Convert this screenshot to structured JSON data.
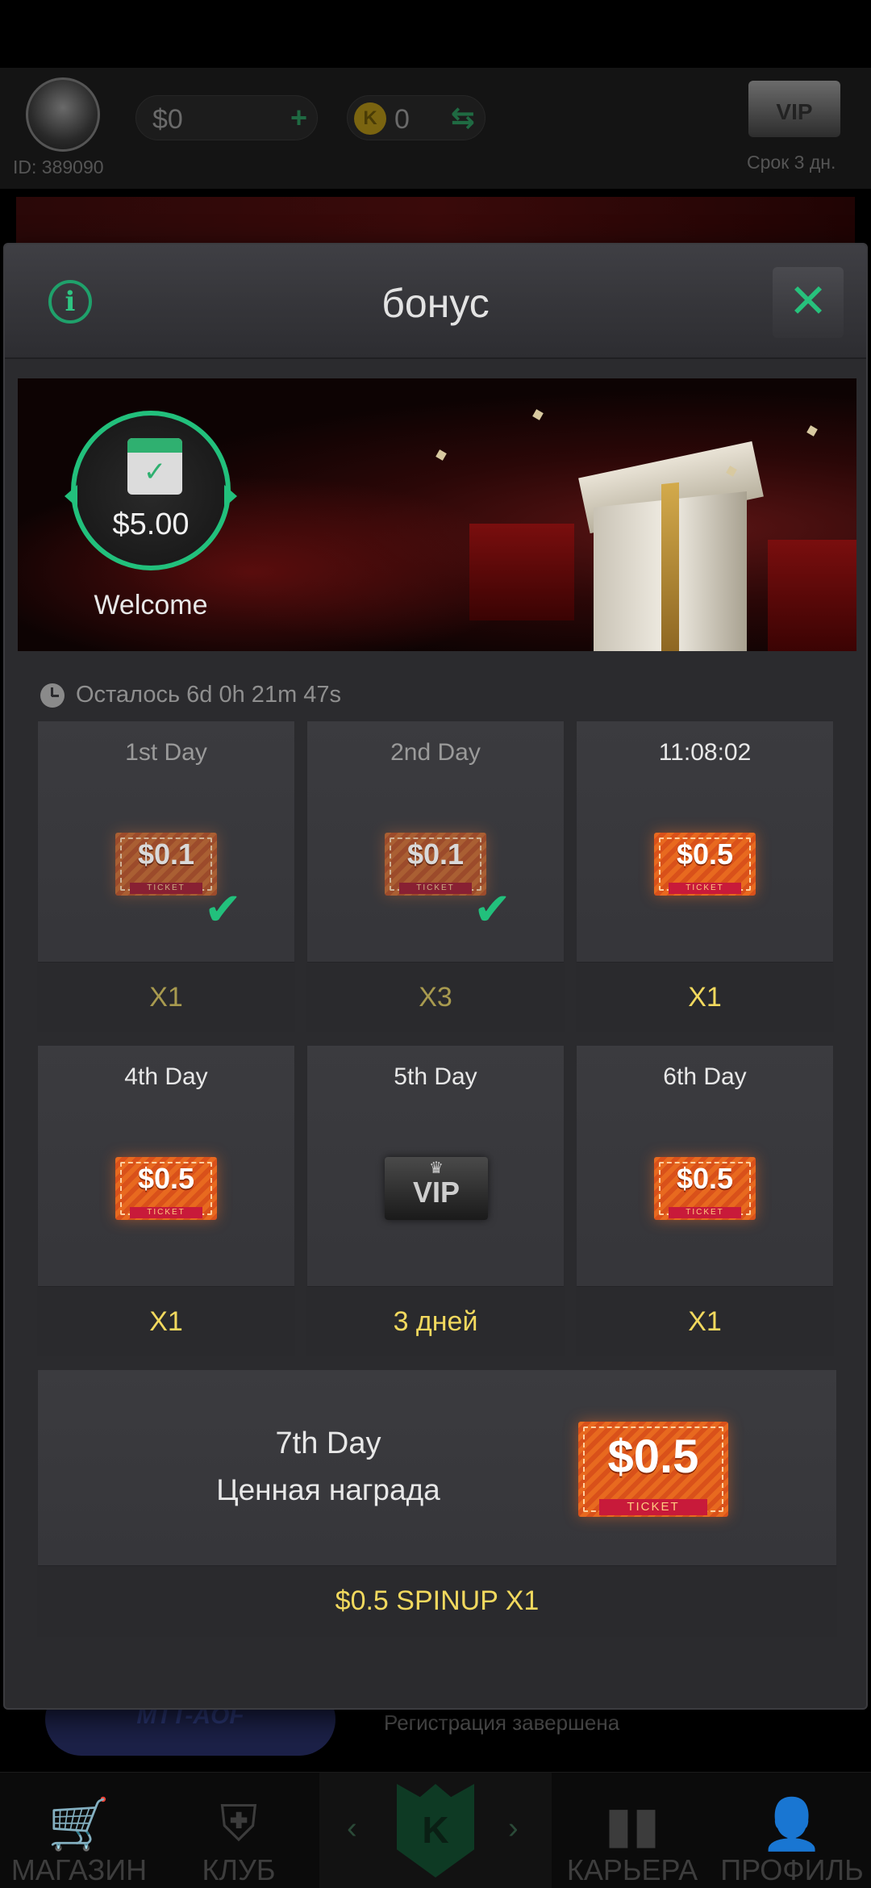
{
  "background": {
    "user_id": "ID: 389090",
    "cash": "$0",
    "cash_action": "+",
    "coin_icon_letter": "K",
    "coins": "0",
    "coin_action": "⇆",
    "vip_label": "VIP",
    "vip_expiry": "Срок 3 дн.",
    "mtt_label": "MTT-AOF",
    "registration_status": "Регистрация завершена",
    "nav": {
      "shop": "МАГАЗИН",
      "club": "КЛУБ",
      "career": "КАРЬЕРА",
      "profile": "ПРОФИЛЬ",
      "center_logo": "K"
    }
  },
  "modal": {
    "title": "бонус",
    "info_glyph": "i",
    "close_glyph": "✕",
    "welcome": {
      "amount": "$5.00",
      "label": "Welcome"
    },
    "time_left": "Осталось 6d 0h 21m 47s",
    "days": [
      {
        "title": "1st Day",
        "ticket": "$0.1",
        "qty": "X1",
        "claimed": true
      },
      {
        "title": "2nd Day",
        "ticket": "$0.1",
        "qty": "X3",
        "claimed": true
      },
      {
        "title": "11:08:02",
        "ticket": "$0.5",
        "qty": "X1",
        "claimed": false
      },
      {
        "title": "4th Day",
        "ticket": "$0.5",
        "qty": "X1",
        "claimed": false
      },
      {
        "title": "5th Day",
        "ticket": "VIP",
        "qty": "3 дней",
        "claimed": false
      },
      {
        "title": "6th Day",
        "ticket": "$0.5",
        "qty": "X1",
        "claimed": false
      }
    ],
    "ticket_word": "TICKET",
    "day7": {
      "title": "7th Day",
      "subtitle": "Ценная награда",
      "ticket": "$0.5",
      "reward": "$0.5 SPINUP X1"
    }
  },
  "colors": {
    "accent_green": "#22c07c",
    "reward_yellow": "#f2d95e",
    "modal_bg": "#2b2b2e",
    "ticket_orange": "#e8691f"
  }
}
